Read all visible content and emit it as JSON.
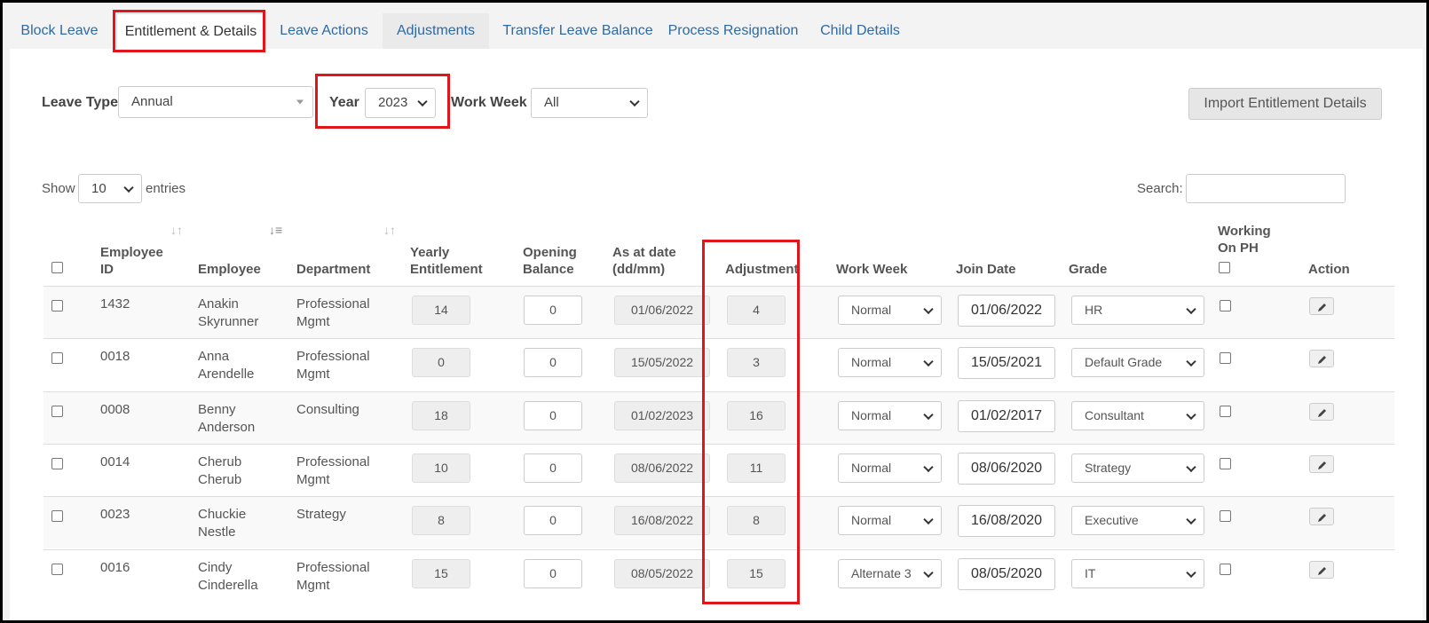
{
  "tabs": [
    "Block Leave",
    "Entitlement & Details",
    "Leave Actions",
    "Adjustments",
    "Transfer Leave Balance",
    "Process Resignation",
    "Child Details"
  ],
  "filters": {
    "leave_type_label": "Leave Type",
    "leave_type_value": "Annual",
    "year_label": "Year",
    "year_value": "2023",
    "work_week_label": "Work Week",
    "work_week_value": "All"
  },
  "import_button": "Import Entitlement Details",
  "show": {
    "prefix": "Show",
    "value": "10",
    "suffix": "entries"
  },
  "search_label": "Search:",
  "columns": {
    "employee_id_1": "Employee",
    "employee_id_2": "ID",
    "employee": "Employee",
    "department": "Department",
    "yearly_1": "Yearly",
    "yearly_2": "Entitlement",
    "opening_1": "Opening",
    "opening_2": "Balance",
    "asat_1": "As at date",
    "asat_2": "(dd/mm)",
    "adjustment": "Adjustment",
    "work_week": "Work Week",
    "join_date": "Join Date",
    "grade": "Grade",
    "working_1": "Working",
    "working_2": "On PH",
    "action": "Action"
  },
  "rows": [
    {
      "id": "1432",
      "name1": "Anakin",
      "name2": "Skyrunner",
      "dept1": "Professional",
      "dept2": "Mgmt",
      "yearly": "14",
      "opening": "0",
      "asat": "01/06/2022",
      "adjustment": "4",
      "work_week": "Normal",
      "join_date": "01/06/2022",
      "grade": "HR"
    },
    {
      "id": "0018",
      "name1": "Anna",
      "name2": "Arendelle",
      "dept1": "Professional",
      "dept2": "Mgmt",
      "yearly": "0",
      "opening": "0",
      "asat": "15/05/2022",
      "adjustment": "3",
      "work_week": "Normal",
      "join_date": "15/05/2021",
      "grade": "Default Grade"
    },
    {
      "id": "0008",
      "name1": "Benny",
      "name2": "Anderson",
      "dept1": "Consulting",
      "dept2": "",
      "yearly": "18",
      "opening": "0",
      "asat": "01/02/2023",
      "adjustment": "16",
      "work_week": "Normal",
      "join_date": "01/02/2017",
      "grade": "Consultant"
    },
    {
      "id": "0014",
      "name1": "Cherub",
      "name2": "Cherub",
      "dept1": "Professional",
      "dept2": "Mgmt",
      "yearly": "10",
      "opening": "0",
      "asat": "08/06/2022",
      "adjustment": "11",
      "work_week": "Normal",
      "join_date": "08/06/2020",
      "grade": "Strategy"
    },
    {
      "id": "0023",
      "name1": "Chuckie",
      "name2": "Nestle",
      "dept1": "Strategy",
      "dept2": "",
      "yearly": "8",
      "opening": "0",
      "asat": "16/08/2022",
      "adjustment": "8",
      "work_week": "Normal",
      "join_date": "16/08/2020",
      "grade": "Executive"
    },
    {
      "id": "0016",
      "name1": "Cindy",
      "name2": "Cinderella",
      "dept1": "Professional",
      "dept2": "Mgmt",
      "yearly": "15",
      "opening": "0",
      "asat": "08/05/2022",
      "adjustment": "15",
      "work_week": "Alternate 3",
      "join_date": "08/05/2020",
      "grade": "IT"
    }
  ],
  "colors": {
    "highlight": "#e2151a",
    "link": "#2d6aa5"
  }
}
